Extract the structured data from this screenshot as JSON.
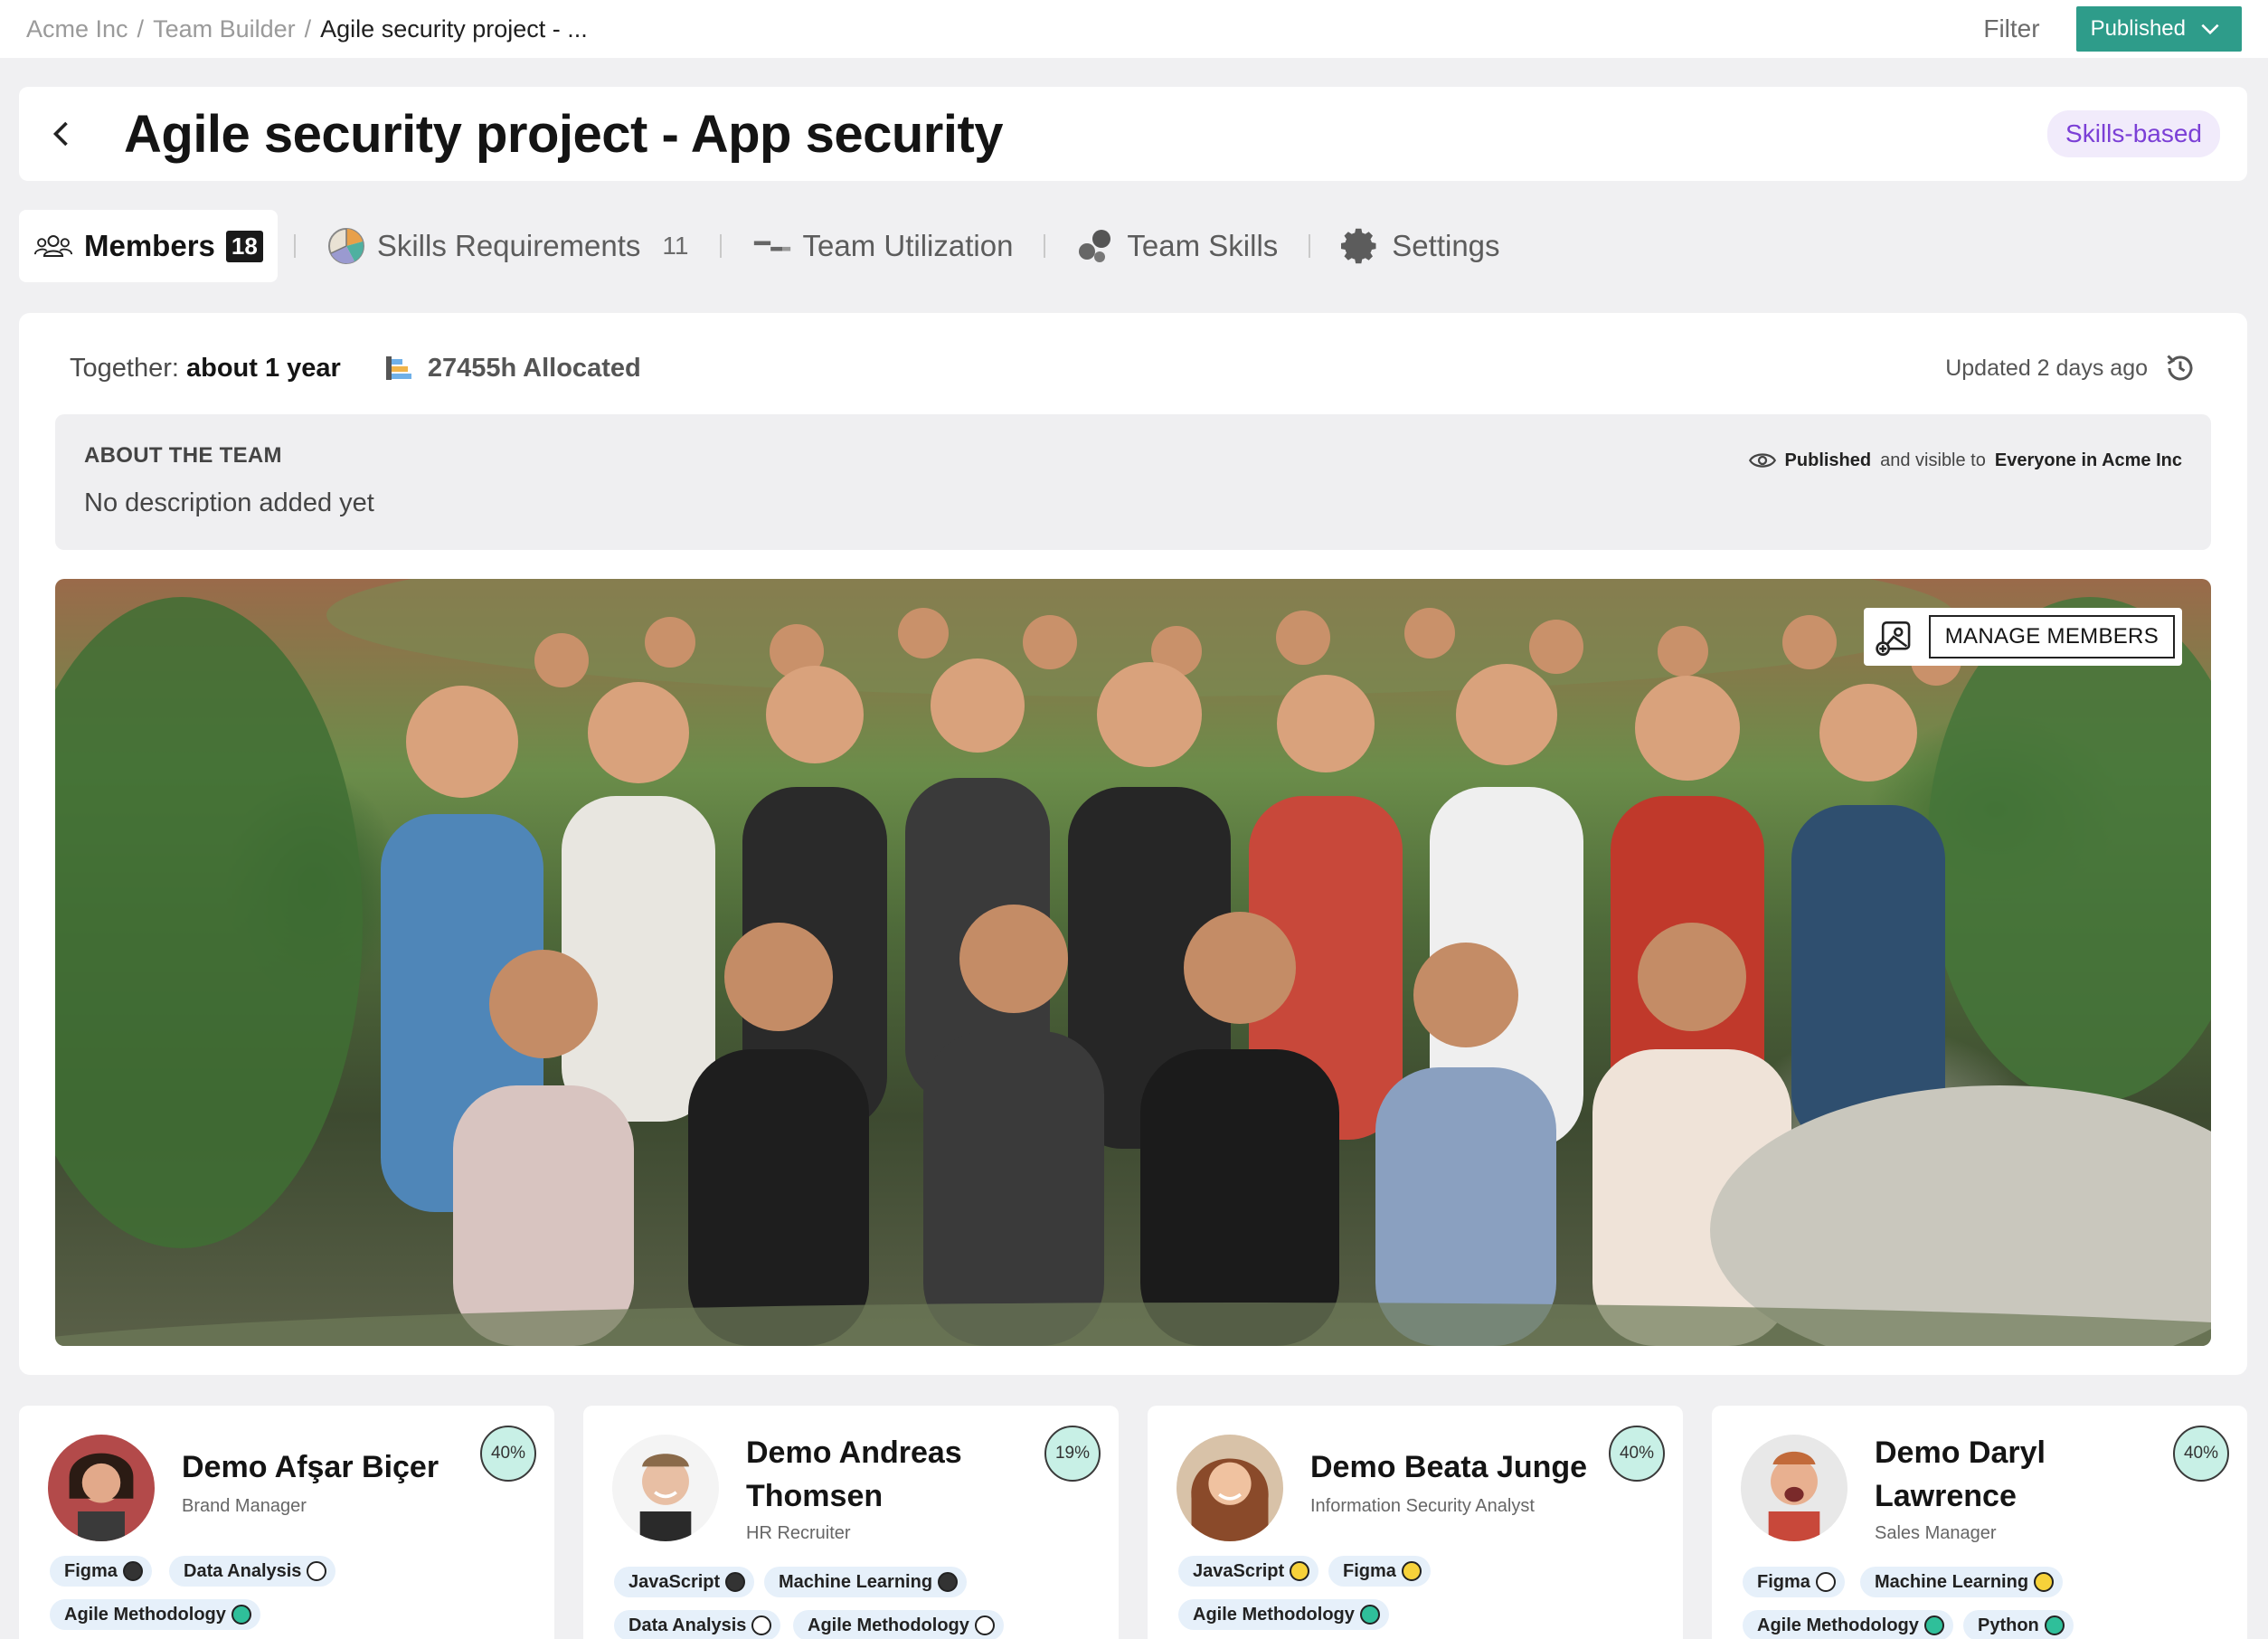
{
  "breadcrumb": {
    "items": [
      "Acme Inc",
      "Team Builder",
      "Agile security project - ..."
    ],
    "separator": "/"
  },
  "topbar": {
    "filter_label": "Filter",
    "status_label": "Published"
  },
  "header": {
    "title": "Agile security project - App security",
    "badge": "Skills-based"
  },
  "tabs": [
    {
      "label": "Members",
      "count": "18",
      "icon": "members-icon"
    },
    {
      "label": "Skills Requirements",
      "count": "11",
      "icon": "pie-chart-icon"
    },
    {
      "label": "Team Utilization",
      "icon": "utilization-icon"
    },
    {
      "label": "Team Skills",
      "icon": "skills-bubbles-icon"
    },
    {
      "label": "Settings",
      "icon": "gear-icon"
    }
  ],
  "stats": {
    "together_label": "Together:",
    "together_value": "about 1 year",
    "allocated": "27455h Allocated",
    "updated": "Updated 2 days ago"
  },
  "about": {
    "title": "ABOUT THE TEAM",
    "description": "No description added yet",
    "visibility_status": "Published",
    "visibility_middle": "and visible to",
    "visibility_audience": "Everyone in Acme Inc"
  },
  "photo": {
    "manage_label": "MANAGE MEMBERS"
  },
  "members": [
    {
      "name": "Demo Afşar Biçer",
      "role": "Brand Manager",
      "pct": "40%",
      "skills": [
        {
          "label": "Figma",
          "dot": "dark"
        },
        {
          "label": "Data Analysis",
          "dot": "empty"
        },
        {
          "label": "Agile Methodology",
          "dot": "teal"
        }
      ]
    },
    {
      "name": "Demo Andreas Thomsen",
      "role": "HR Recruiter",
      "pct": "19%",
      "skills": [
        {
          "label": "JavaScript",
          "dot": "dark"
        },
        {
          "label": "Machine Learning",
          "dot": "dark"
        },
        {
          "label": "Data Analysis",
          "dot": "empty"
        },
        {
          "label": "Agile Methodology",
          "dot": "empty"
        }
      ]
    },
    {
      "name": "Demo Beata Junge",
      "role": "Information Security Analyst",
      "pct": "40%",
      "skills": [
        {
          "label": "JavaScript",
          "dot": "yellow"
        },
        {
          "label": "Figma",
          "dot": "yellow"
        },
        {
          "label": "Agile Methodology",
          "dot": "teal"
        }
      ]
    },
    {
      "name": "Demo Daryl Lawrence",
      "role": "Sales Manager",
      "pct": "40%",
      "skills": [
        {
          "label": "Figma",
          "dot": "empty"
        },
        {
          "label": "Machine Learning",
          "dot": "yellow"
        },
        {
          "label": "Agile Methodology",
          "dot": "teal"
        },
        {
          "label": "Python",
          "dot": "teal"
        }
      ]
    }
  ],
  "colors": {
    "accent_green": "#2e9c8a",
    "badge_purple": "#7b3fd6",
    "badge_bg": "#f1ebfb",
    "skill_chip_bg": "#e6f0fa",
    "percent_bg": "#c8f0e6"
  }
}
